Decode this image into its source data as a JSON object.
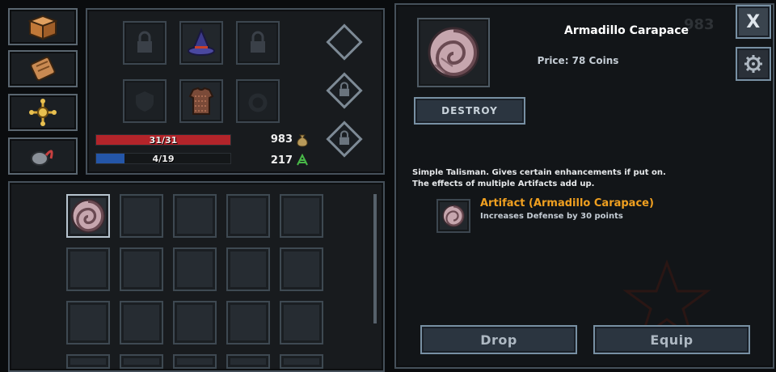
{
  "side_tabs": [
    {
      "name": "inventory-box-icon"
    },
    {
      "name": "scroll-icon"
    },
    {
      "name": "talisman-icon"
    },
    {
      "name": "hook-icon"
    }
  ],
  "stats": {
    "hp": {
      "text": "31/31",
      "fill": 1.0,
      "color": "#b3242a"
    },
    "mp": {
      "text": "4/19",
      "fill": 0.21,
      "color": "#2456a8"
    },
    "coins": "983",
    "herbs": "217"
  },
  "ghost_coins": "983",
  "item": {
    "title": "Armadillo Carapace",
    "price": "Price: 78 Coins",
    "destroy_label": "DESTROY",
    "description_line1": "Simple Talisman. Gives certain enhancements if put on.",
    "description_line2": "The effects of multiple Artifacts add up.",
    "effect_title": "Artifact (Armadillo Carapace)",
    "effect_desc": "Increases Defense by 30 points",
    "accent": "#f0a020"
  },
  "actions": {
    "drop_label": "Drop",
    "equip_label": "Equip"
  },
  "close_label": "X"
}
